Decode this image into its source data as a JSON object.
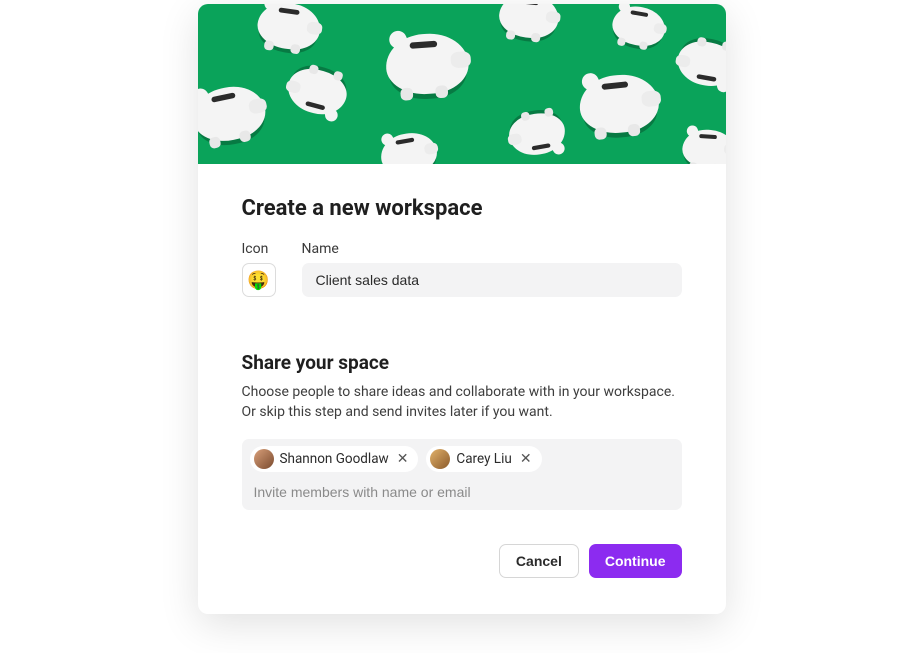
{
  "dialog": {
    "title": "Create a new workspace",
    "icon": {
      "label": "Icon",
      "emoji": "🤑"
    },
    "name": {
      "label": "Name",
      "value": "Client sales data"
    },
    "share": {
      "heading": "Share your space",
      "description": "Choose people to share ideas and collaborate with in your workspace. Or skip this step and send invites later if you want.",
      "members": [
        {
          "name": "Shannon Goodlaw",
          "avatar_bg": "linear-gradient(135deg,#d9a07a,#7a4a2e)"
        },
        {
          "name": "Carey Liu",
          "avatar_bg": "linear-gradient(135deg,#e2b26a,#8b5a2b)"
        }
      ],
      "invite_placeholder": "Invite members with name or email"
    },
    "actions": {
      "cancel": "Cancel",
      "continue": "Continue"
    }
  }
}
